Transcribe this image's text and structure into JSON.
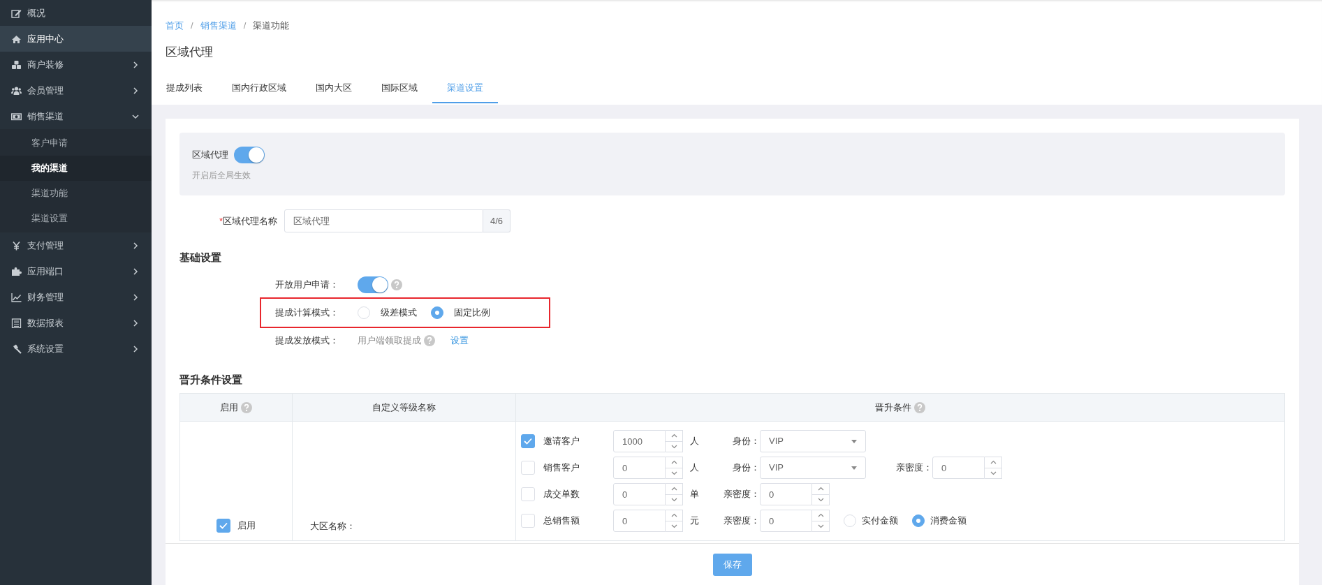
{
  "sidebar": {
    "items": [
      {
        "label": "概况",
        "selected": false,
        "has_children": false
      },
      {
        "label": "应用中心",
        "selected": true,
        "has_children": false
      },
      {
        "label": "商户装修",
        "selected": false,
        "has_children": true,
        "expanded": false
      },
      {
        "label": "会员管理",
        "selected": false,
        "has_children": true,
        "expanded": false
      },
      {
        "label": "销售渠道",
        "selected": false,
        "has_children": true,
        "expanded": true,
        "children": [
          {
            "label": "客户申请",
            "selected": false
          },
          {
            "label": "我的渠道",
            "selected": true
          },
          {
            "label": "渠道功能",
            "selected": false
          },
          {
            "label": "渠道设置",
            "selected": false
          }
        ]
      },
      {
        "label": "支付管理",
        "selected": false,
        "has_children": true,
        "expanded": false
      },
      {
        "label": "应用端口",
        "selected": false,
        "has_children": true,
        "expanded": false
      },
      {
        "label": "财务管理",
        "selected": false,
        "has_children": true,
        "expanded": false
      },
      {
        "label": "数据报表",
        "selected": false,
        "has_children": true,
        "expanded": false
      },
      {
        "label": "系统设置",
        "selected": false,
        "has_children": true,
        "expanded": false
      }
    ]
  },
  "breadcrumb": {
    "separator": "/",
    "items": [
      "首页",
      "销售渠道",
      "渠道功能"
    ]
  },
  "page_title": "区域代理",
  "tabs": [
    {
      "label": "提成列表",
      "selected": false
    },
    {
      "label": "国内行政区域",
      "selected": false
    },
    {
      "label": "国内大区",
      "selected": false
    },
    {
      "label": "国际区域",
      "selected": false
    },
    {
      "label": "渠道设置",
      "selected": true
    }
  ],
  "banner": {
    "label": "区域代理",
    "on": true,
    "hint": "开启后全局生效"
  },
  "name_field": {
    "required_mark": "*",
    "label": "区域代理名称",
    "value": "区域代理",
    "counter": "4/6"
  },
  "basic_settings": {
    "title": "基础设置",
    "rows": [
      {
        "kind": "toggle",
        "label": "开放用户申请：",
        "on": true,
        "help": true,
        "highlighted": false
      },
      {
        "kind": "radio",
        "label": "提成计算模式：",
        "highlighted": true,
        "options": [
          {
            "label": "级差模式",
            "selected": false
          },
          {
            "label": "固定比例",
            "selected": true
          }
        ]
      },
      {
        "kind": "text",
        "label": "提成发放模式：",
        "value": "用户端领取提成",
        "help": true,
        "link": "设置",
        "highlighted": false
      }
    ]
  },
  "promotion": {
    "title": "晋升条件设置",
    "columns": [
      {
        "label": "启用",
        "help": true
      },
      {
        "label": "自定义等级名称",
        "help": false
      },
      {
        "label": "晋升条件",
        "help": true
      }
    ],
    "row": {
      "enable": {
        "label": "启用",
        "checked": true
      },
      "name_label": "大区名称：",
      "conditions": [
        {
          "label": "邀请客户",
          "checked": true,
          "value": "1000",
          "unit": "人",
          "identity": {
            "label": "身份：",
            "value": "VIP"
          }
        },
        {
          "label": "销售客户",
          "checked": false,
          "value": "0",
          "unit": "人",
          "identity": {
            "label": "身份：",
            "value": "VIP"
          },
          "intimacy": {
            "label": "亲密度：",
            "value": "0"
          }
        },
        {
          "label": "成交单数",
          "checked": false,
          "value": "0",
          "unit": "单",
          "intimacy": {
            "label": "亲密度：",
            "value": "0"
          }
        },
        {
          "label": "总销售额",
          "checked": false,
          "value": "0",
          "unit": "元",
          "intimacy": {
            "label": "亲密度：",
            "value": "0"
          },
          "amount_options": [
            {
              "label": "实付金额",
              "selected": false
            },
            {
              "label": "消费金额",
              "selected": true
            }
          ]
        }
      ]
    }
  },
  "footer": {
    "save": "保存"
  }
}
